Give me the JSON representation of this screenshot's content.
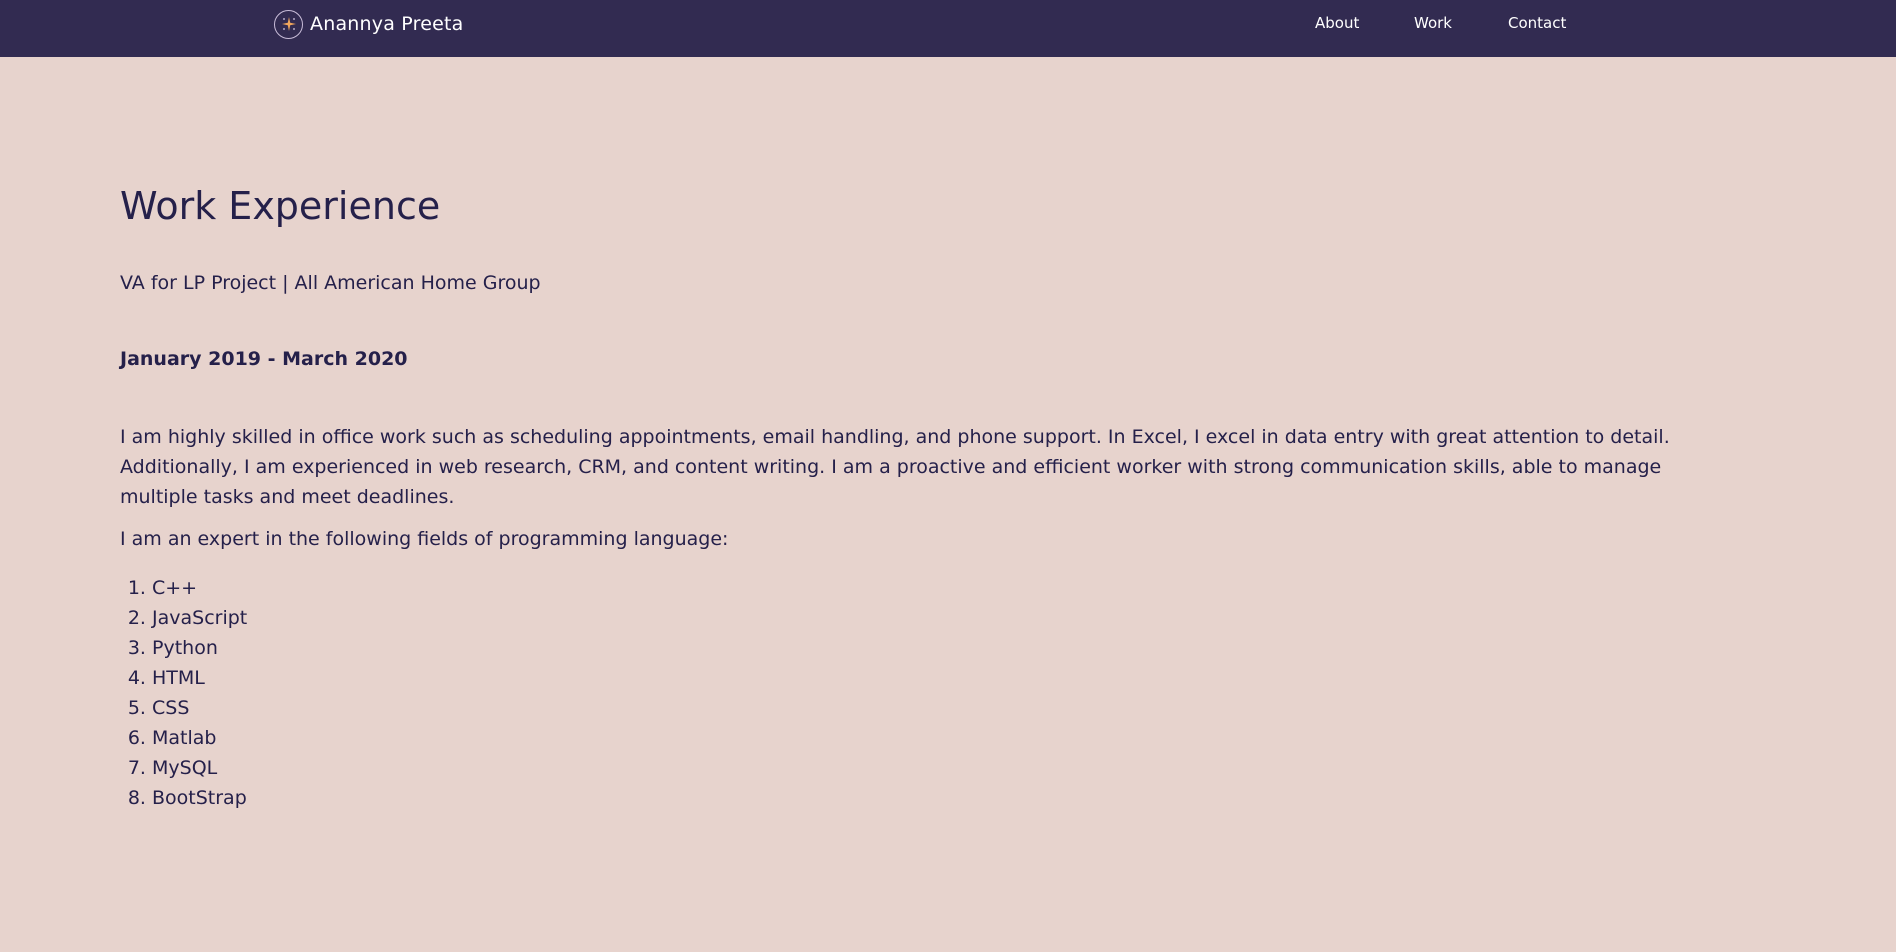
{
  "nav": {
    "brand": "Anannya Preeta",
    "links": [
      "About",
      "Work",
      "Contact"
    ]
  },
  "main": {
    "heading": "Work Experience",
    "role": "VA for LP Project | All American Home Group",
    "dates": "January 2019 - March 2020",
    "summary": "I am highly skilled in office work such as scheduling appointments, email handling, and phone support. In Excel, I excel in data entry with great attention to detail. Additionally, I am experienced in web research, CRM, and content writing. I am a proactive and efficient worker with strong communication skills, able to manage multiple tasks and meet deadlines.",
    "skills_intro": "I am an expert in the following fields of programming language:",
    "skills": [
      "C++",
      "JavaScript",
      "Python",
      "HTML",
      "CSS",
      "Matlab",
      "MySQL",
      "BootStrap"
    ]
  },
  "colors": {
    "navbar": "#322b51",
    "background": "#e7d3cd",
    "text": "#25204a",
    "logo_accent": "#f0a65c"
  }
}
